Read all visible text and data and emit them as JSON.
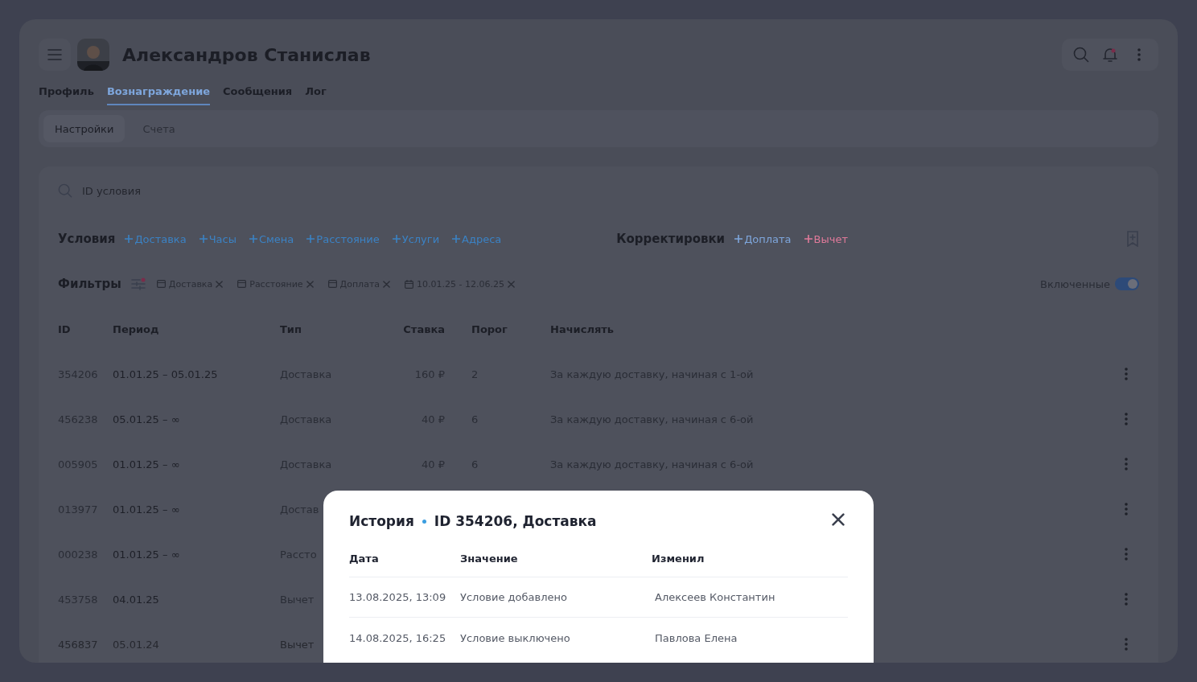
{
  "header": {
    "title": "Александров Станислав"
  },
  "tabs": [
    {
      "label": "Профиль",
      "selected": false
    },
    {
      "label": "Вознаграждение",
      "selected": true
    },
    {
      "label": "Сообщения",
      "selected": false
    },
    {
      "label": "Лог",
      "selected": false
    }
  ],
  "subtabs": [
    {
      "label": "Настройки",
      "selected": true
    },
    {
      "label": "Счета",
      "selected": false
    }
  ],
  "search": {
    "placeholder": "ID условия"
  },
  "conditions": {
    "title": "Условия",
    "items": [
      "Доставка",
      "Часы",
      "Смена",
      "Расстояние",
      "Услуги",
      "Адреса"
    ]
  },
  "adjustments": {
    "title": "Корректировки",
    "items": [
      {
        "label": "Доплата",
        "color": "#7ea6dc"
      },
      {
        "label": "Вычет",
        "color": "#e07a9a"
      }
    ]
  },
  "filters": {
    "title": "Фильтры",
    "chips": [
      {
        "label": "Доставка",
        "kind": "category"
      },
      {
        "label": "Расстояние",
        "kind": "category"
      },
      {
        "label": "Доплата",
        "kind": "category"
      },
      {
        "label": "10.01.25 - 12.06.25",
        "kind": "date"
      }
    ],
    "toggle": {
      "label": "Включенные",
      "on": true
    }
  },
  "table": {
    "columns": [
      "ID",
      "Период",
      "Тип",
      "Ставка",
      "Порог",
      "Начислять"
    ],
    "rows": [
      {
        "id": "354206",
        "period": "01.01.25 – 05.01.25",
        "type": "Доставка",
        "rate": "160 ₽",
        "threshold": "2",
        "accrual": "За каждую доставку, начиная с 1-ой"
      },
      {
        "id": "456238",
        "period": "05.01.25 – ∞",
        "type": "Доставка",
        "rate": "40 ₽",
        "threshold": "6",
        "accrual": "За каждую доставку, начиная с 6-ой"
      },
      {
        "id": "005905",
        "period": "01.01.25 – ∞",
        "type": "Доставка",
        "rate": "40 ₽",
        "threshold": "6",
        "accrual": "За каждую доставку, начиная с 6-ой"
      },
      {
        "id": "013977",
        "period": "01.01.25 – ∞",
        "type": "Достав"
      },
      {
        "id": "000238",
        "period": "01.01.25 – ∞",
        "type": "Рассто"
      },
      {
        "id": "453758",
        "period": "04.01.25",
        "type": "Вычет"
      },
      {
        "id": "456837",
        "period": "05.01.24",
        "type": "Вычет"
      }
    ]
  },
  "history": {
    "title": "История",
    "subtitle": "ID 354206, Доставка",
    "columns": [
      "Дата",
      "Значение",
      "Изменил"
    ],
    "rows": [
      {
        "date": "13.08.2025,  13:09",
        "value": "Условие добавлено",
        "author": "Алексеев Константин"
      },
      {
        "date": "14.08.2025,  16:25",
        "value": "Условие выключено",
        "author": "Павлова Елена"
      }
    ]
  }
}
